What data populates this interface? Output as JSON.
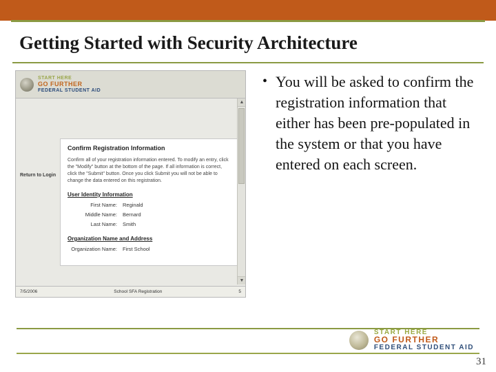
{
  "slide": {
    "title": "Getting Started with Security Architecture",
    "page_number": "31"
  },
  "bullet": {
    "text": "You will be asked to confirm the registration information that either has been pre-populated in the system or that you have entered on each screen."
  },
  "screenshot": {
    "brand_line1": "START HERE",
    "brand_line2": "GO FURTHER",
    "brand_line3": "FEDERAL STUDENT AID",
    "left_nav": "Return to Login",
    "card_title": "Confirm Registration Information",
    "card_desc": "Confirm all of your registration information entered. To modify an entry, click the \"Modify\" button at the bottom of the page. If all information is correct, click the \"Submit\" button. Once you click Submit you will not be able to change the data entered on this registration.",
    "section1": "User Identity Information",
    "fields": {
      "first_name_label": "First Name:",
      "first_name_value": "Reginald",
      "middle_name_label": "Middle Name:",
      "middle_name_value": "Bernard",
      "last_name_label": "Last Name:",
      "last_name_value": "Smith"
    },
    "section2": "Organization Name and Address",
    "section2_sub_label": "Organization Name:",
    "section2_sub_value": "First School",
    "footer_left": "7/5/2006",
    "footer_center": "School SFA Registration",
    "footer_right": "5"
  },
  "footer_brand": {
    "line1": "START HERE",
    "line2": "GO FURTHER",
    "line3": "FEDERAL STUDENT AID"
  }
}
